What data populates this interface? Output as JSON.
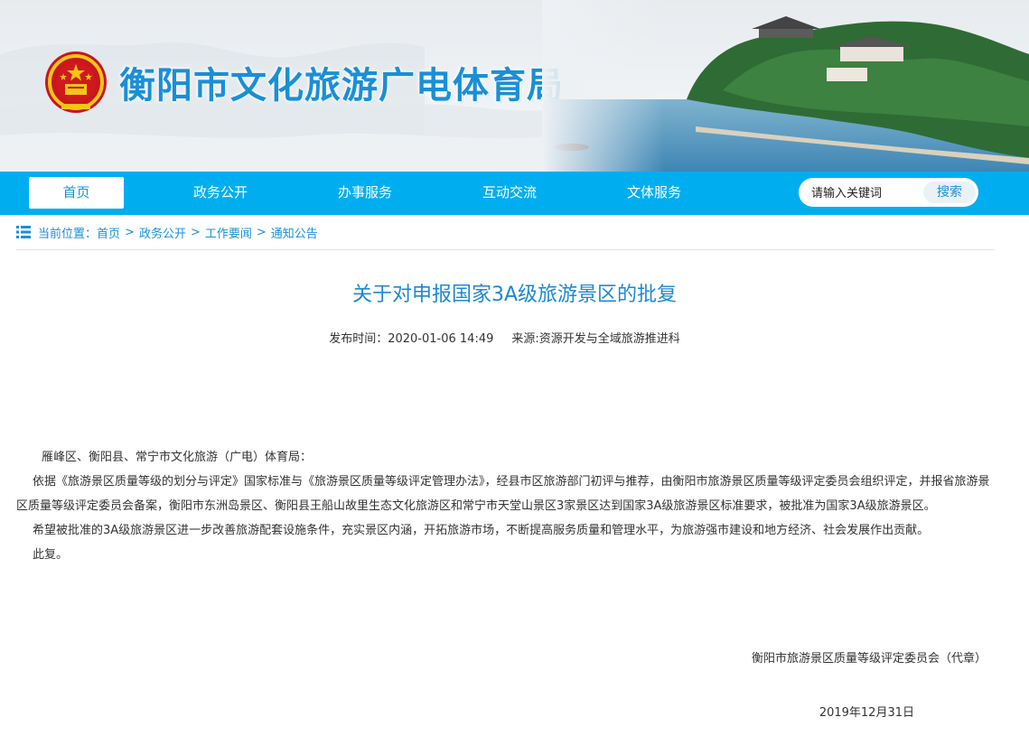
{
  "banner": {
    "site_title": "衡阳市文化旅游广电体育局"
  },
  "nav": {
    "items": [
      {
        "label": "首页",
        "active": true
      },
      {
        "label": "政务公开"
      },
      {
        "label": "办事服务"
      },
      {
        "label": "互动交流"
      },
      {
        "label": "文体服务"
      }
    ],
    "search": {
      "placeholder": "请输入关键词",
      "button": "搜索"
    }
  },
  "breadcrumb": {
    "prefix": "当前位置：",
    "items": [
      "首页",
      "政务公开",
      "工作要闻",
      "通知公告"
    ],
    "separator": ">"
  },
  "article": {
    "title": "关于对申报国家3A级旅游景区的批复",
    "publish_time": "发布时间：2020-01-06 14:49",
    "source": "来源:资源开发与全域旅游推进科",
    "salutation": "雁峰区、衡阳县、常宁市文化旅游（广电）体育局：",
    "paragraphs": [
      "依据《旅游景区质量等级的划分与评定》国家标准与《旅游景区质量等级评定管理办法》，经县市区旅游部门初评与推荐，由衡阳市旅游景区质量等级评定委员会组织评定，并报省旅游景区质量等级评定委员会备案，衡阳市东洲岛景区、衡阳县王船山故里生态文化旅游区和常宁市天堂山景区3家景区达到国家3A级旅游景区标准要求，被批准为国家3A级旅游景区。",
      "希望被批准的3A级旅游景区进一步改善旅游配套设施条件，充实景区内涵，开拓旅游市场，不断提高服务质量和管理水平，为旅游强市建设和地方经济、社会发展作出贡献。",
      "此复。"
    ],
    "signature": "衡阳市旅游景区质量等级评定委员会（代章）",
    "date": "2019年12月31日"
  },
  "colors": {
    "nav_bg": "#00aef0",
    "accent": "#1a8fd6"
  }
}
